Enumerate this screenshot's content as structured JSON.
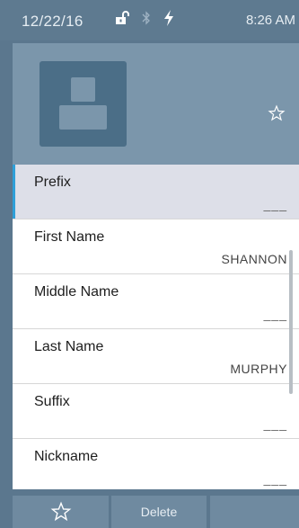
{
  "status": {
    "date": "12/22/16",
    "time": "8:26 AM",
    "icons": [
      "lock-open-icon",
      "bluetooth-icon",
      "charging-bolt-icon"
    ]
  },
  "contact": {
    "avatar_icon": "person-icon",
    "favorite_icon": "star-outline-icon"
  },
  "fields": [
    {
      "label": "Prefix",
      "value": "___",
      "selected": true
    },
    {
      "label": "First Name",
      "value": "SHANNON"
    },
    {
      "label": "Middle Name",
      "value": "___"
    },
    {
      "label": "Last Name",
      "value": "MURPHY"
    },
    {
      "label": "Suffix",
      "value": "___"
    },
    {
      "label": "Nickname",
      "value": "___"
    }
  ],
  "actions": {
    "favorite_icon": "star-outline-icon",
    "delete_label": "Delete"
  },
  "colors": {
    "accent": "#2e9fd8",
    "header": "#7b96ab",
    "avatar": "#4b6e87"
  }
}
